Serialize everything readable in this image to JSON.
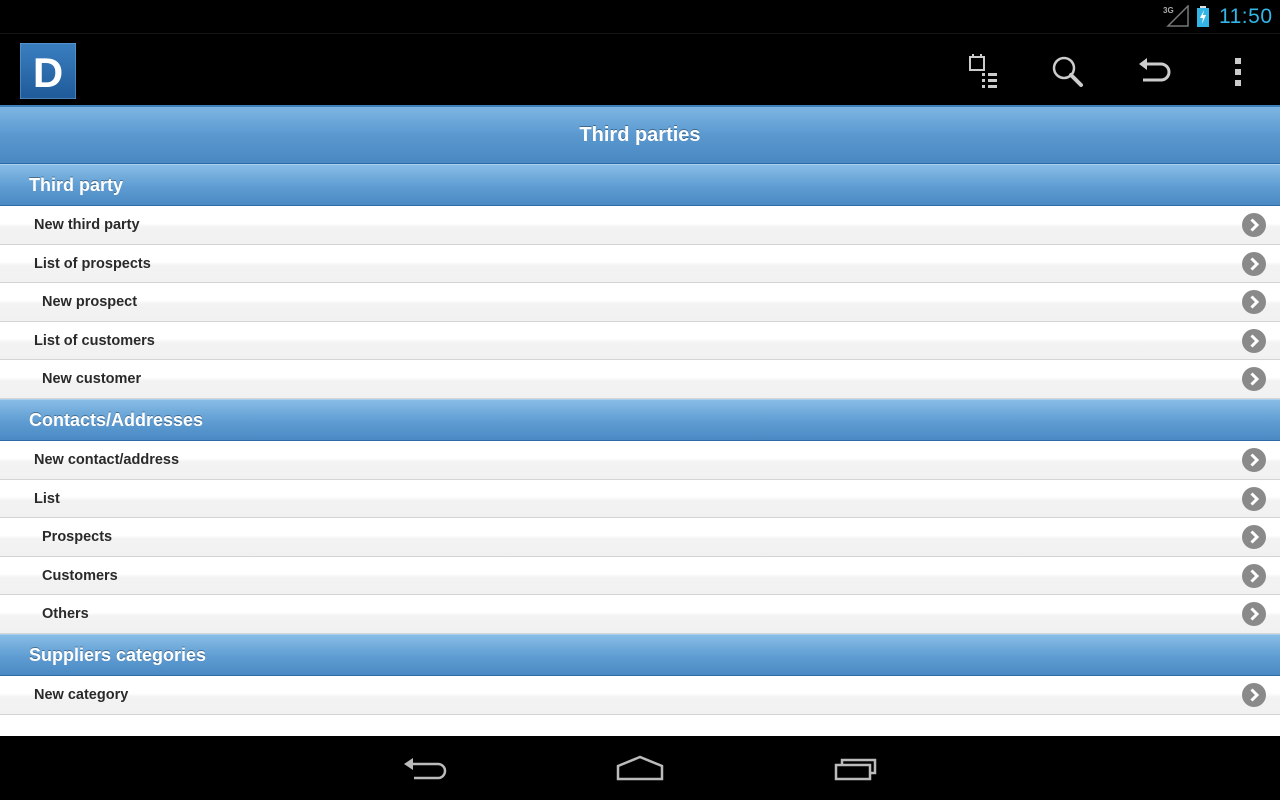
{
  "status_bar": {
    "network": "3G",
    "time": "11:50",
    "icons": [
      "signal-icon",
      "battery-charging-icon"
    ]
  },
  "action_bar": {
    "logo_letter": "D",
    "actions": [
      "calendar-list-icon",
      "search-icon",
      "undo-icon",
      "overflow-menu-icon"
    ]
  },
  "page": {
    "title": "Third parties"
  },
  "sections": [
    {
      "header": "Third party",
      "items": [
        {
          "label": "New third party"
        },
        {
          "label": "List of prospects"
        },
        {
          "label": "New prospect"
        },
        {
          "label": "List of customers"
        },
        {
          "label": "New customer"
        }
      ]
    },
    {
      "header": "Contacts/Addresses",
      "items": [
        {
          "label": "New contact/address"
        },
        {
          "label": "List"
        },
        {
          "label": "Prospects"
        },
        {
          "label": "Customers"
        },
        {
          "label": "Others"
        }
      ]
    },
    {
      "header": "Suppliers categories",
      "items": [
        {
          "label": "New category"
        }
      ]
    }
  ],
  "colors": {
    "accent": "#33b5e5",
    "header_blue": "#5a98cf",
    "chevron": "#8a8a8a"
  }
}
